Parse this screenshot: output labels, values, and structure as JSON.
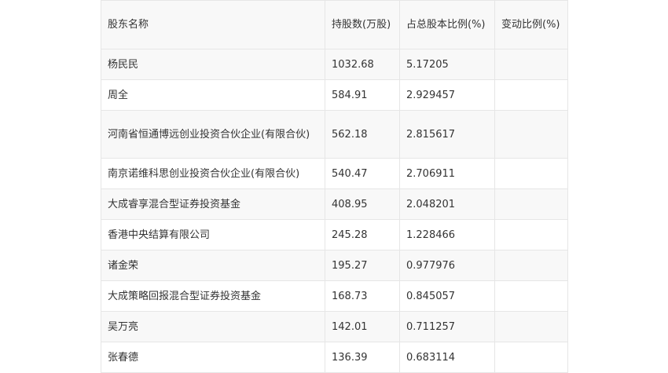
{
  "table": {
    "headers": [
      "股东名称",
      "持股数(万股)",
      "占总股本比例(%)",
      "变动比例(%)"
    ],
    "rows": [
      {
        "name": "杨民民",
        "shares": "1032.68",
        "ratio": "5.17205",
        "change": ""
      },
      {
        "name": "周全",
        "shares": "584.91",
        "ratio": "2.929457",
        "change": ""
      },
      {
        "name": "河南省恒通博远创业投资合伙企业(有限合伙)",
        "shares": "562.18",
        "ratio": "2.815617",
        "change": ""
      },
      {
        "name": "南京诺维科思创业投资合伙企业(有限合伙)",
        "shares": "540.47",
        "ratio": "2.706911",
        "change": ""
      },
      {
        "name": "大成睿享混合型证券投资基金",
        "shares": "408.95",
        "ratio": "2.048201",
        "change": ""
      },
      {
        "name": "香港中央结算有限公司",
        "shares": "245.28",
        "ratio": "1.228466",
        "change": ""
      },
      {
        "name": "诸金荣",
        "shares": "195.27",
        "ratio": "0.977976",
        "change": ""
      },
      {
        "name": "大成策略回报混合型证券投资基金",
        "shares": "168.73",
        "ratio": "0.845057",
        "change": ""
      },
      {
        "name": "吴万亮",
        "shares": "142.01",
        "ratio": "0.711257",
        "change": ""
      },
      {
        "name": "张春德",
        "shares": "136.39",
        "ratio": "0.683114",
        "change": ""
      }
    ]
  }
}
